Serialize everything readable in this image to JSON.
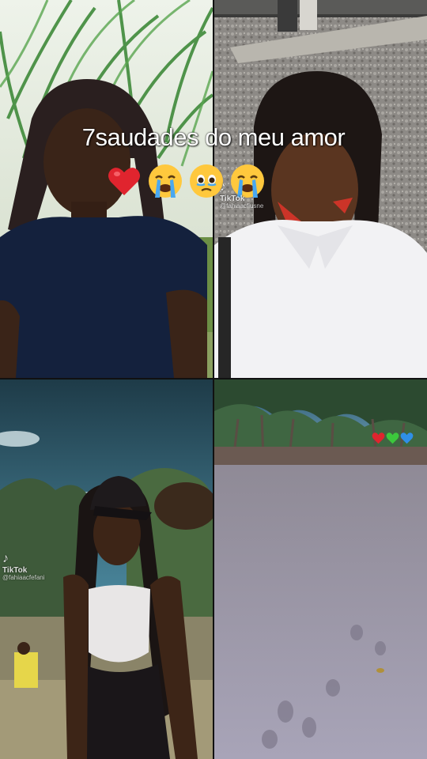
{
  "caption": {
    "text": "7saudades do meu amor"
  },
  "emojis": {
    "heart": "red-heart-icon",
    "cry1": "loudly-crying-face-icon",
    "hold_tears": "face-holding-back-tears-icon",
    "cry2": "loudly-crying-face-icon"
  },
  "watermark_top": {
    "note": "♪",
    "brand": "TikTok",
    "handle": "@fahiaacfiusne"
  },
  "watermark_bottom": {
    "note": "♪",
    "brand": "TikTok",
    "handle": "@fahiaacfefani"
  },
  "small_hearts": [
    "red",
    "green",
    "blue"
  ],
  "colors": {
    "heart_red": "#e0242e",
    "heart_green": "#3cc83c",
    "heart_blue": "#2f8fe8",
    "emoji_yellow": "#ffc83d",
    "tear_blue": "#4aa8f0"
  }
}
